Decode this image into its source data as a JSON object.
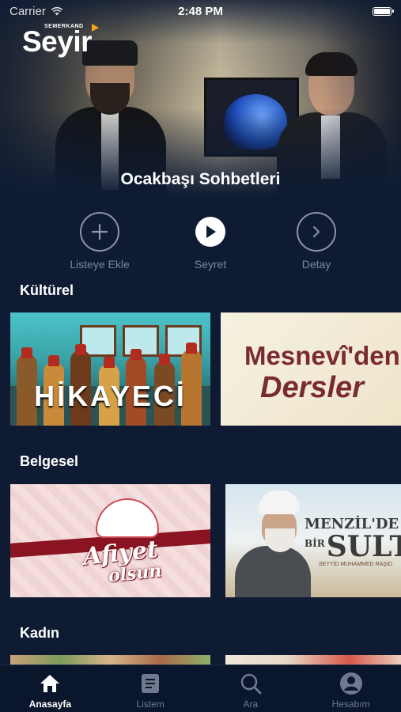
{
  "status_bar": {
    "carrier": "Carrier",
    "time": "2:48 PM"
  },
  "app": {
    "brand_small": "SEMERKAND",
    "brand_big": "Seyir"
  },
  "hero": {
    "title": "Ocakbaşı Sohbetleri"
  },
  "actions": [
    {
      "label": "Listeye Ekle",
      "icon": "plus-icon"
    },
    {
      "label": "Seyret",
      "icon": "play-icon"
    },
    {
      "label": "Detay",
      "icon": "chevron-right-icon"
    }
  ],
  "sections": [
    {
      "title": "Kültürel",
      "cards": [
        {
          "title": "HİKAYECİ"
        },
        {
          "title_line1": "Mesnevî'den",
          "title_line2": "Dersler"
        }
      ]
    },
    {
      "title": "Belgesel",
      "cards": [
        {
          "title_line1": "Afiyet",
          "title_line2": "olsun"
        },
        {
          "title_line1": "MENZİL'DE",
          "title_small": "BİR",
          "title_line2": "SULTAN",
          "subtitle": "SEYYİD MUHAMMED RAŞİD"
        }
      ]
    },
    {
      "title": "Kadın"
    }
  ],
  "tabbar": {
    "items": [
      {
        "label": "Anasayfa",
        "icon": "home-icon",
        "active": true
      },
      {
        "label": "Listem",
        "icon": "list-icon",
        "active": false
      },
      {
        "label": "Ara",
        "icon": "search-icon",
        "active": false
      },
      {
        "label": "Hesabım",
        "icon": "account-icon",
        "active": false
      }
    ]
  },
  "colors": {
    "background": "#0e1b33",
    "tabbar": "#0a162b",
    "accent": "#f7a21b",
    "muted_text": "#7b879b"
  }
}
